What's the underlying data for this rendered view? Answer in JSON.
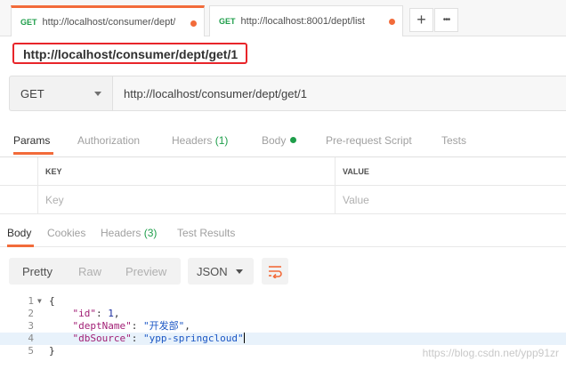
{
  "tabs": [
    {
      "method": "GET",
      "url": "http://localhost/consumer/dept/",
      "active": true
    },
    {
      "method": "GET",
      "url": "http://localhost:8001/dept/list",
      "active": false
    }
  ],
  "tab_actions": {
    "new_tab": "+",
    "more": "•••"
  },
  "request_name": "http://localhost/consumer/dept/get/1",
  "request": {
    "method": "GET",
    "url": "http://localhost/consumer/dept/get/1"
  },
  "request_tabs": {
    "params": "Params",
    "authorization": "Authorization",
    "headers": "Headers",
    "headers_count": "(1)",
    "body": "Body",
    "pre_request": "Pre-request Script",
    "tests": "Tests"
  },
  "params_table": {
    "key_header": "KEY",
    "value_header": "VALUE",
    "key_placeholder": "Key",
    "value_placeholder": "Value"
  },
  "response_tabs": {
    "body": "Body",
    "cookies": "Cookies",
    "headers": "Headers",
    "headers_count": "(3)",
    "test_results": "Test Results"
  },
  "response_toolbar": {
    "pretty": "Pretty",
    "raw": "Raw",
    "preview": "Preview",
    "format": "JSON"
  },
  "response_body": {
    "lines": [
      "1",
      "2",
      "3",
      "4",
      "5"
    ],
    "open_brace": "{",
    "close_brace": "}",
    "id_key": "\"id\"",
    "id_value": "1",
    "dept_name_key": "\"deptName\"",
    "dept_name_value": "\"开发部\"",
    "db_source_key": "\"dbSource\"",
    "db_source_value": "\"ypp-springcloud\""
  },
  "watermark": "https://blog.csdn.net/ypp91zr",
  "colors": {
    "accent": "#f26b3a",
    "method_green": "#1e9e4a",
    "highlight_red": "#e8252a"
  }
}
